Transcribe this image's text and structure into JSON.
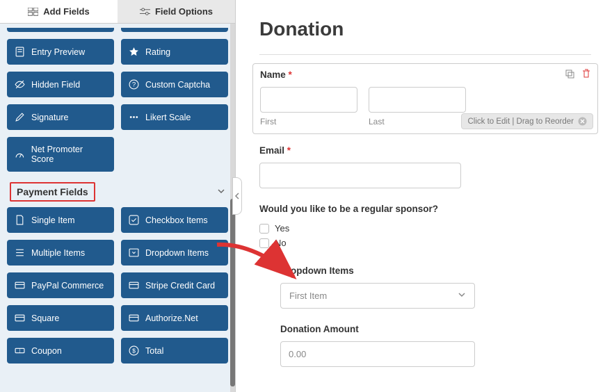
{
  "tabs": {
    "add": "Add Fields",
    "options": "Field Options"
  },
  "fancy": {
    "items": [
      {
        "label": "Entry Preview",
        "icon": "doc"
      },
      {
        "label": "Rating",
        "icon": "star"
      },
      {
        "label": "Hidden Field",
        "icon": "eye-off"
      },
      {
        "label": "Custom Captcha",
        "icon": "question"
      },
      {
        "label": "Signature",
        "icon": "pencil"
      },
      {
        "label": "Likert Scale",
        "icon": "dots"
      },
      {
        "label": "Net Promoter Score",
        "icon": "gauge"
      }
    ]
  },
  "payment": {
    "title": "Payment Fields",
    "items": [
      {
        "label": "Single Item",
        "icon": "file"
      },
      {
        "label": "Checkbox Items",
        "icon": "check"
      },
      {
        "label": "Multiple Items",
        "icon": "list"
      },
      {
        "label": "Dropdown Items",
        "icon": "drop"
      },
      {
        "label": "PayPal Commerce",
        "icon": "card"
      },
      {
        "label": "Stripe Credit Card",
        "icon": "card"
      },
      {
        "label": "Square",
        "icon": "card"
      },
      {
        "label": "Authorize.Net",
        "icon": "card"
      },
      {
        "label": "Coupon",
        "icon": "ticket"
      },
      {
        "label": "Total",
        "icon": "sum"
      }
    ]
  },
  "form": {
    "title": "Donation",
    "name": {
      "label": "Name",
      "first": "First",
      "last": "Last"
    },
    "email": {
      "label": "Email"
    },
    "sponsor": {
      "label": "Would you like to be a regular sponsor?",
      "yes": "Yes",
      "no": "No"
    },
    "dropdown": {
      "label": "Dropdown Items",
      "value": "First Item"
    },
    "donation": {
      "label": "Donation Amount",
      "value": "0.00"
    },
    "hint": "Click to Edit | Drag to Reorder"
  },
  "colors": {
    "primary": "#215a8d",
    "danger": "#d33"
  }
}
